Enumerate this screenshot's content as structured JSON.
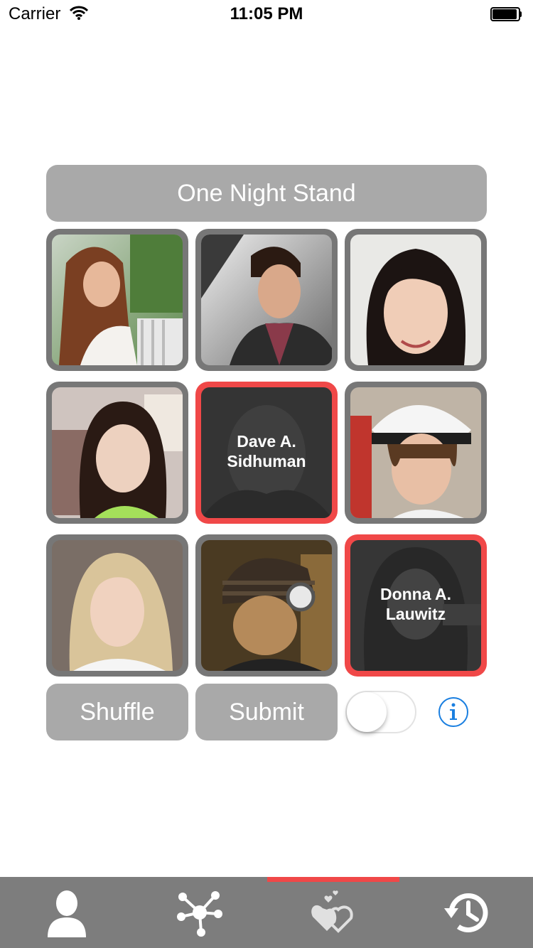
{
  "status_bar": {
    "carrier": "Carrier",
    "time": "11:05 PM"
  },
  "title": "One Night Stand",
  "grid": {
    "tiles": [
      {
        "selected": false,
        "name": ""
      },
      {
        "selected": false,
        "name": ""
      },
      {
        "selected": false,
        "name": ""
      },
      {
        "selected": false,
        "name": ""
      },
      {
        "selected": true,
        "name": "Dave A.\nSidhuman"
      },
      {
        "selected": false,
        "name": ""
      },
      {
        "selected": false,
        "name": ""
      },
      {
        "selected": false,
        "name": ""
      },
      {
        "selected": true,
        "name": "Donna A.\nLauwitz"
      }
    ]
  },
  "actions": {
    "shuffle_label": "Shuffle",
    "submit_label": "Submit",
    "toggle_on": false
  },
  "tab_bar": {
    "tabs": [
      {
        "icon": "person-icon"
      },
      {
        "icon": "network-icon"
      },
      {
        "icon": "hearts-icon",
        "active": true
      },
      {
        "icon": "history-icon"
      }
    ]
  },
  "colors": {
    "accent": "#f04848",
    "button_gray": "#a9a9a9",
    "tile_border": "#777777",
    "tab_bar": "#7d7d7d",
    "info_blue": "#1a7fe0"
  }
}
